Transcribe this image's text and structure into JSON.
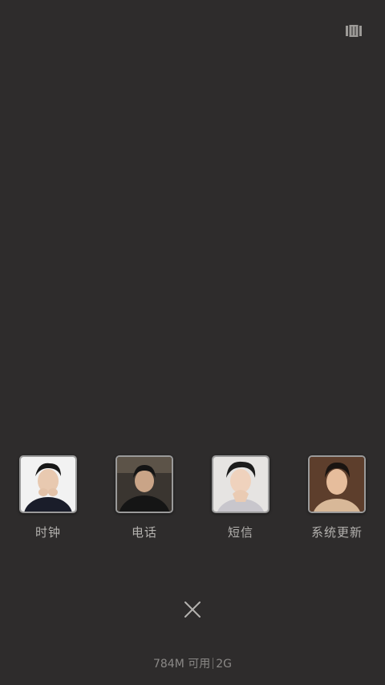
{
  "toolbar": {
    "toggle_icon": "layout-columns-icon"
  },
  "recent_apps": [
    {
      "label": "时钟",
      "thumbnail": "portrait-white-background"
    },
    {
      "label": "电话",
      "thumbnail": "portrait-dark-background"
    },
    {
      "label": "短信",
      "thumbnail": "portrait-light-background"
    },
    {
      "label": "系统更新",
      "thumbnail": "portrait-warm-background"
    }
  ],
  "close": {
    "icon": "close-icon"
  },
  "memory": {
    "available": "784M 可用",
    "total": "2G"
  },
  "colors": {
    "background": "#2e2c2c",
    "label": "#b3b1ae",
    "memory_text": "#8a8886"
  }
}
